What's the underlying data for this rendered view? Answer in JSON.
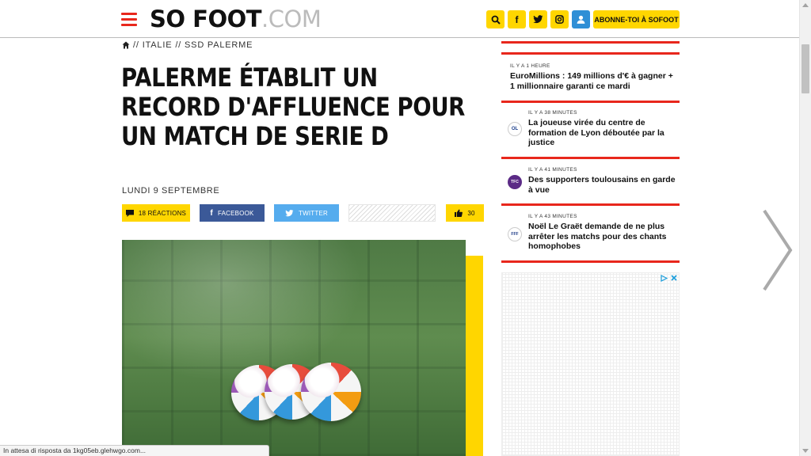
{
  "header": {
    "logo_main": "SO FOOT",
    "logo_suffix": ".COM",
    "subscribe_label": "ABONNE-TOI À SOFOOT",
    "icons": [
      "search-icon",
      "facebook-icon",
      "twitter-icon",
      "instagram-icon",
      "user-icon"
    ],
    "facebook_glyph": "f",
    "accent_color": "#e8271c",
    "yellow_color": "#ffd600"
  },
  "article": {
    "breadcrumb": [
      "ITALIE",
      "SSD PALERME"
    ],
    "breadcrumb_separator": "//",
    "title": "PALERME ÉTABLIT UN RECORD D'AFFLUENCE POUR UN MATCH DE SERIE D",
    "date": "LUNDI 9 SEPTEMBRE",
    "reactions_label": "18 RÉACTIONS",
    "facebook_label": "FACEBOOK",
    "twitter_label": "TWITTER",
    "likes_count": "30"
  },
  "sidebar": {
    "news": [
      {
        "time": "IL Y A 1 HEURE",
        "title": "EuroMillions : 149 millions d'€ à gagner + 1 millionnaire garanti ce mardi",
        "badge": ""
      },
      {
        "time": "IL Y A 38 MINUTES",
        "title": "La joueuse virée du centre de formation de Lyon déboutée par la justice",
        "badge": "OL"
      },
      {
        "time": "IL Y A 41 MINUTES",
        "title": "Des supporters toulousains en garde à vue",
        "badge": "TFC"
      },
      {
        "time": "IL Y A 43 MINUTES",
        "title": "Noël Le Graët demande de ne plus arrêter les matchs pour des chants homophobes",
        "badge": "FFF"
      }
    ]
  },
  "status_bar": "In attesa di risposta da 1kg05eb.glehwgo.com..."
}
